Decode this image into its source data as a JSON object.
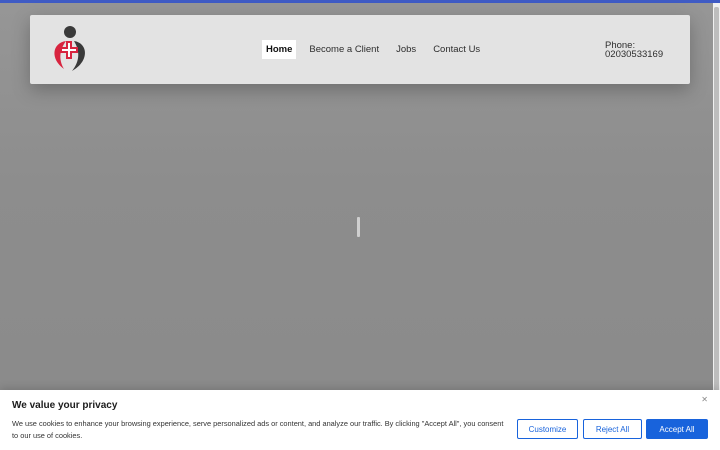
{
  "colors": {
    "accent": "#1863dc",
    "top_strip": "#3f5bc4",
    "logo_red": "#d8243f",
    "logo_dark": "#3a3a3a"
  },
  "header": {
    "logo_icon": "caregiver-cross-logo",
    "nav": [
      {
        "label": "Home",
        "active": true
      },
      {
        "label": "Become a Client",
        "active": false
      },
      {
        "label": "Jobs",
        "active": false
      },
      {
        "label": "Contact Us",
        "active": false
      }
    ],
    "phone_label": "Phone:",
    "phone_number": "02030533169"
  },
  "cookie_banner": {
    "title": "We value your privacy",
    "text": "We use cookies to enhance your browsing experience, serve personalized ads or content, and analyze our traffic. By clicking \"Accept All\", you consent to our use of cookies.",
    "close_icon": "close-icon",
    "customize_label": "Customize",
    "reject_label": "Reject All",
    "accept_label": "Accept All"
  }
}
